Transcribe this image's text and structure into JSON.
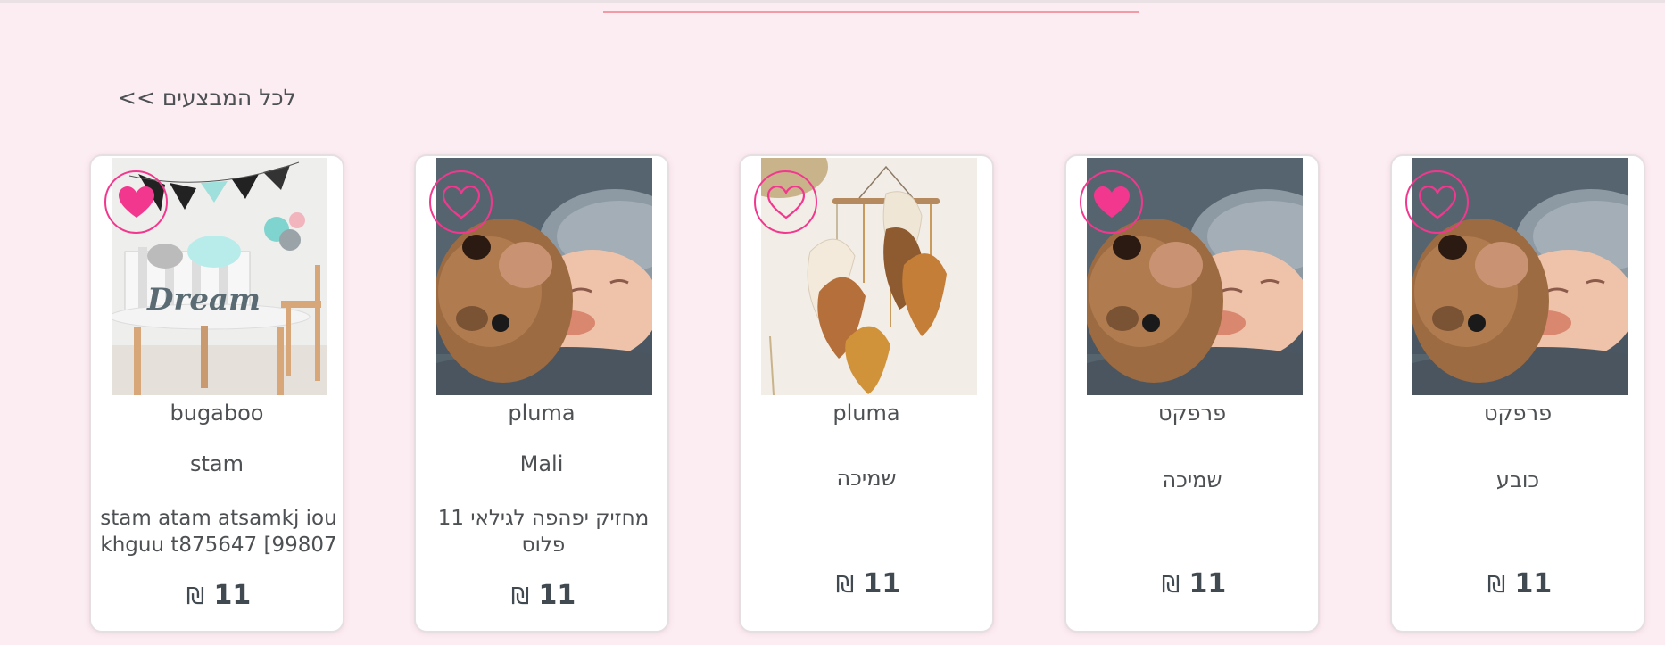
{
  "nav": {
    "all_performers_link": "לכל המבצעים >>"
  },
  "cards": [
    {
      "brand": "bugaboo",
      "name": "stam",
      "description": "stam atam atsamkj iou khguu t875647 [99807",
      "price": "11",
      "currency": "₪",
      "favorite": true,
      "image_icon": "nursery-room-image"
    },
    {
      "brand": "pluma",
      "name": "Mali",
      "description": "מחזיק יפהפה לגילאי 11 פלוס",
      "price": "11",
      "currency": "₪",
      "favorite": false,
      "image_icon": "baby-with-teddy-bear-image"
    },
    {
      "brand": "pluma",
      "name": "שמיכה",
      "description": "",
      "price": "11",
      "currency": "₪",
      "favorite": false,
      "image_icon": "macrame-leaves-image"
    },
    {
      "brand": "פרפקט",
      "name": "שמיכה",
      "description": "",
      "price": "11",
      "currency": "₪",
      "favorite": true,
      "image_icon": "baby-with-teddy-bear-image"
    },
    {
      "brand": "פרפקט",
      "name": "כובע",
      "description": "",
      "price": "11",
      "currency": "₪",
      "favorite": false,
      "image_icon": "baby-with-teddy-bear-image"
    }
  ],
  "colors": {
    "background": "#fcedf2",
    "accent_pink": "#f2388e",
    "divider": "#f29aa6",
    "text": "#4d5154"
  }
}
